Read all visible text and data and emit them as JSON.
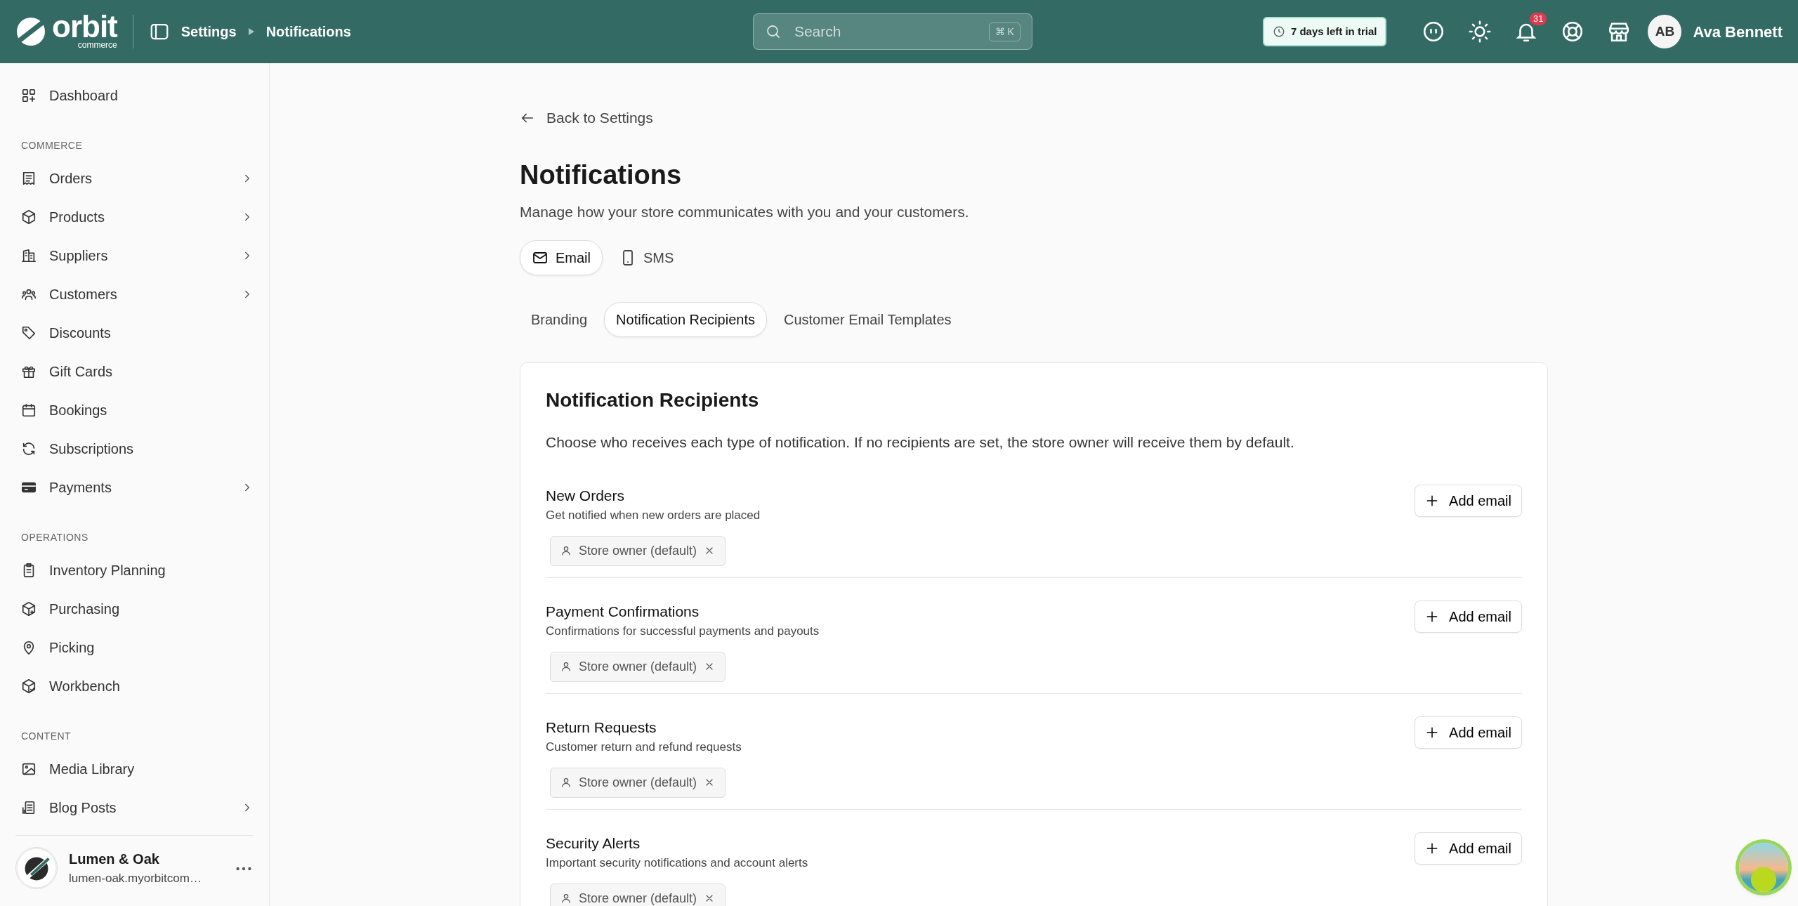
{
  "topbar": {
    "logo": {
      "word": "orbit",
      "tagline": "commerce"
    },
    "breadcrumb": [
      {
        "label": "Settings"
      },
      {
        "label": "Notifications"
      }
    ],
    "search": {
      "placeholder": "Search",
      "shortcut": "⌘ K"
    },
    "trial": "7 days left in trial",
    "notification_count": "31",
    "user": {
      "initials": "AB",
      "name": "Ava Bennett"
    }
  },
  "sidebar": {
    "sections": [
      {
        "items": [
          {
            "label": "Dashboard",
            "expandable": false
          }
        ]
      },
      {
        "heading": "COMMERCE",
        "items": [
          {
            "label": "Orders",
            "expandable": true
          },
          {
            "label": "Products",
            "expandable": true
          },
          {
            "label": "Suppliers",
            "expandable": true
          },
          {
            "label": "Customers",
            "expandable": true
          },
          {
            "label": "Discounts",
            "expandable": false
          },
          {
            "label": "Gift Cards",
            "expandable": false
          },
          {
            "label": "Bookings",
            "expandable": false
          },
          {
            "label": "Subscriptions",
            "expandable": false
          },
          {
            "label": "Payments",
            "expandable": true
          }
        ]
      },
      {
        "heading": "OPERATIONS",
        "items": [
          {
            "label": "Inventory Planning",
            "expandable": false
          },
          {
            "label": "Purchasing",
            "expandable": false
          },
          {
            "label": "Picking",
            "expandable": false
          },
          {
            "label": "Workbench",
            "expandable": false
          }
        ]
      },
      {
        "heading": "CONTENT",
        "items": [
          {
            "label": "Media Library",
            "expandable": false
          },
          {
            "label": "Blog Posts",
            "expandable": true
          }
        ]
      }
    ],
    "store": {
      "name": "Lumen & Oak",
      "url": "lumen-oak.myorbitcom…"
    }
  },
  "main": {
    "back_link": "Back to Settings",
    "title": "Notifications",
    "subtitle": "Manage how your store communicates with you and your customers.",
    "channel_tabs": [
      {
        "label": "Email",
        "selected": true
      },
      {
        "label": "SMS",
        "selected": false
      }
    ],
    "section_tabs": [
      {
        "label": "Branding",
        "selected": false
      },
      {
        "label": "Notification Recipients",
        "selected": true
      },
      {
        "label": "Customer Email Templates",
        "selected": false
      }
    ],
    "card": {
      "title": "Notification Recipients",
      "description": "Choose who receives each type of notification. If no recipients are set, the store owner will receive them by default.",
      "groups": [
        {
          "title": "New Orders",
          "description": "Get notified when new orders are placed",
          "button": "Add email",
          "recipients": [
            "Store owner (default)"
          ]
        },
        {
          "title": "Payment Confirmations",
          "description": "Confirmations for successful payments and payouts",
          "button": "Add email",
          "recipients": [
            "Store owner (default)"
          ]
        },
        {
          "title": "Return Requests",
          "description": "Customer return and refund requests",
          "button": "Add email",
          "recipients": [
            "Store owner (default)"
          ]
        },
        {
          "title": "Security Alerts",
          "description": "Important security notifications and account alerts",
          "button": "Add email",
          "recipients": [
            "Store owner (default)"
          ]
        }
      ]
    }
  }
}
